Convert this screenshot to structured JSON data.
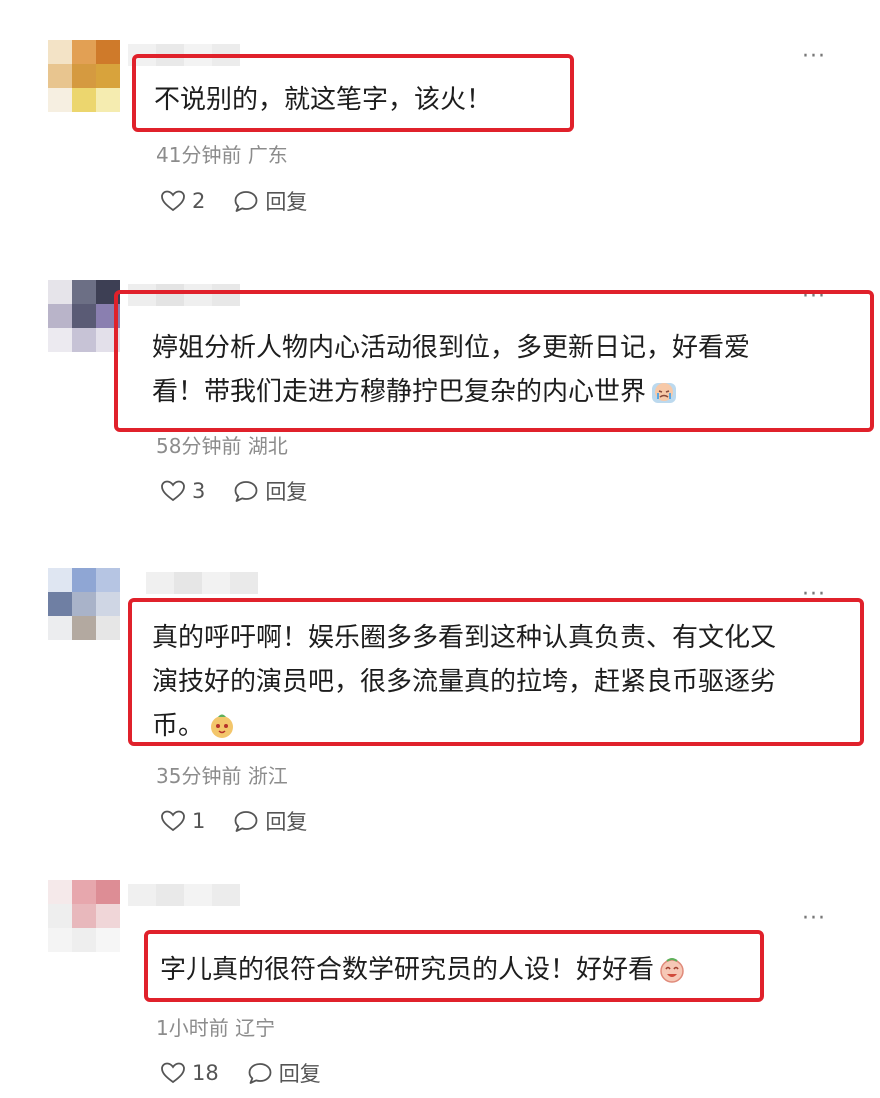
{
  "more_label": "···",
  "reply_label": "回复",
  "comments": [
    {
      "text_lines": [
        "不说别的，就这笔字，该火！"
      ],
      "time": "41分钟前",
      "location": "广东",
      "likes": "2",
      "avatar_colors": [
        "#f3e3c6",
        "#e2a054",
        "#cf7a2a",
        "#e8c58f",
        "#d59a40",
        "#d8a33c",
        "#f6efe1",
        "#ecd66e",
        "#f5ecb0"
      ],
      "name_colors": [
        "#f1f1f1",
        "#e9e9e9",
        "#f3f3f3",
        "#ececec"
      ],
      "emoji": ""
    },
    {
      "text_lines": [
        "婷姐分析人物内心活动很到位，多更新日记，好看爱",
        "看！带我们走进方穆静拧巴复杂的内心世界"
      ],
      "time": "58分钟前",
      "location": "湖北",
      "likes": "3",
      "avatar_colors": [
        "#e6e4ea",
        "#6c6f85",
        "#3d3f54",
        "#b9b4c9",
        "#5a5b75",
        "#8a7fb0",
        "#eceaf0",
        "#c7c3d6",
        "#e3e0ea"
      ],
      "name_colors": [
        "#eeeeee",
        "#e4e4e4",
        "#efefef",
        "#e8e8e8"
      ],
      "emoji": "crying-face-emoji"
    },
    {
      "text_lines": [
        "真的呼吁啊！娱乐圈多多看到这种认真负责、有文化又",
        "演技好的演员吧，很多流量真的拉垮，赶紧良币驱逐劣",
        "币。"
      ],
      "time": "35分钟前",
      "location": "浙江",
      "likes": "1",
      "avatar_colors": [
        "#dfe6f2",
        "#8fa6d4",
        "#b6c5e3",
        "#6f7fa3",
        "#a9b3c9",
        "#cfd6e4",
        "#ecedef",
        "#b3a9a0",
        "#e6e6e6"
      ],
      "name_colors": [
        "#f0f0f0",
        "#e6e6e6",
        "#f2f2f2",
        "#eaeaea"
      ],
      "emoji": "cute-face-emoji"
    },
    {
      "text_lines": [
        "字儿真的很符合数学研究员的人设！好好看"
      ],
      "time": "1小时前",
      "location": "辽宁",
      "likes": "18",
      "avatar_colors": [
        "#f5e9ea",
        "#e7a7ad",
        "#dd8d95",
        "#eeeeee",
        "#e8b8bc",
        "#f0d6d8",
        "#f4f4f4",
        "#eeeeee",
        "#f6f6f6"
      ],
      "name_colors": [
        "#f0f0f0",
        "#e9e9e9",
        "#f3f3f3",
        "#ececec"
      ],
      "emoji": "laughing-face-emoji"
    }
  ]
}
